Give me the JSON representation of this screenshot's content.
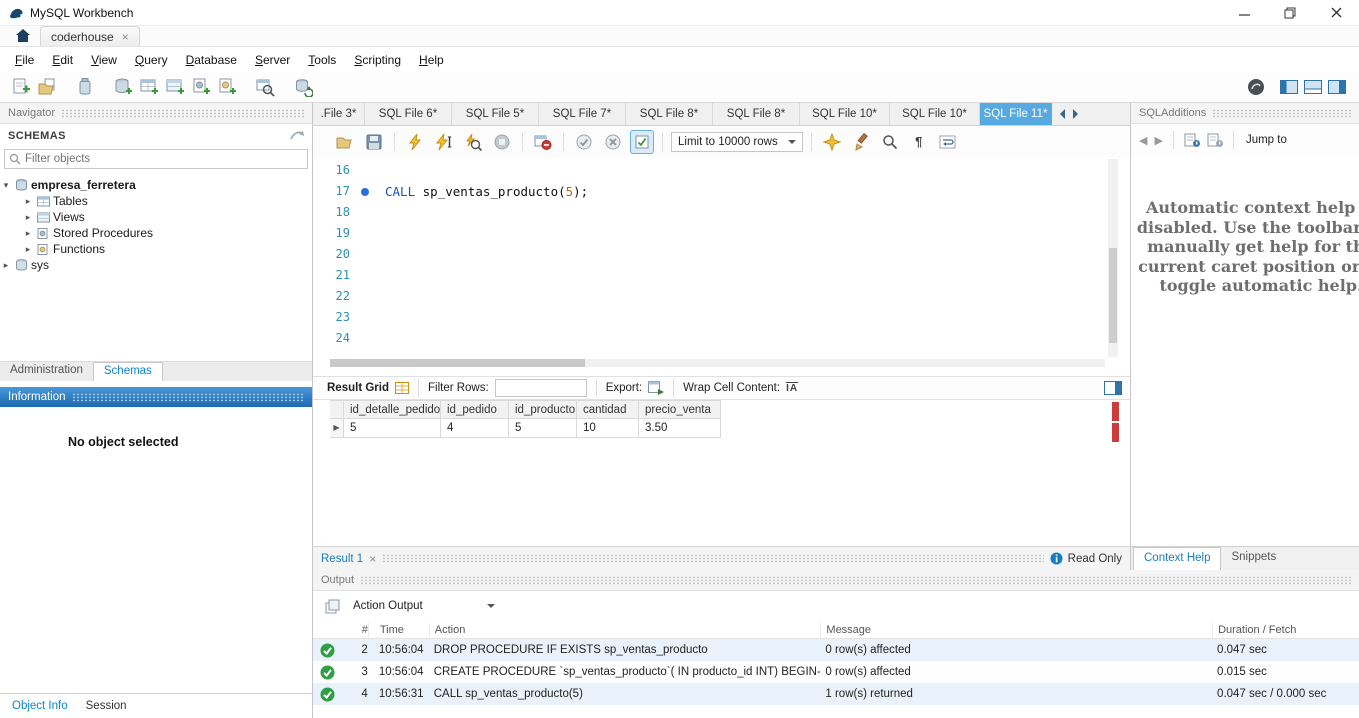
{
  "window": {
    "title": "MySQL Workbench"
  },
  "main_tabs": {
    "tab": "coderhouse",
    "close": "×"
  },
  "menu": {
    "items": [
      "File",
      "Edit",
      "View",
      "Query",
      "Database",
      "Server",
      "Tools",
      "Scripting",
      "Help"
    ]
  },
  "sql_tabs": {
    "items": [
      ".File 3*",
      "SQL File 6*",
      "SQL File 5*",
      "SQL File 7*",
      "SQL File 8*",
      "SQL File 8*",
      "SQL File 10*",
      "SQL File 10*",
      "SQL File 11*"
    ]
  },
  "editor_toolbar": {
    "limit": "Limit to 10000 rows"
  },
  "editor": {
    "line_numbers": [
      "16",
      "17",
      "18",
      "19",
      "20",
      "21",
      "22",
      "23",
      "24"
    ],
    "code_line": {
      "keyword": "CALL",
      "text": " sp_ventas_producto(",
      "number": "5",
      "suffix": ");"
    }
  },
  "navigator": {
    "title": "Navigator",
    "schemas": "SCHEMAS",
    "filter_placeholder": "Filter objects",
    "tree": {
      "schema": "empresa_ferretera",
      "children": [
        "Tables",
        "Views",
        "Stored Procedures",
        "Functions"
      ],
      "schema2": "sys"
    },
    "tabs": {
      "administration": "Administration",
      "schemas": "Schemas"
    }
  },
  "information": {
    "title": "Information",
    "message": "No object selected"
  },
  "bottom_tabs": {
    "object_info": "Object Info",
    "session": "Session"
  },
  "result_toolbar": {
    "grid_label": "Result Grid",
    "filter_label": "Filter Rows:",
    "export_label": "Export:",
    "wrap_label": "Wrap Cell Content:"
  },
  "result_grid": {
    "columns": [
      "id_detalle_pedido",
      "id_pedido",
      "id_producto",
      "cantidad",
      "precio_venta"
    ],
    "rows": [
      [
        "5",
        "4",
        "5",
        "10",
        "3.50"
      ]
    ]
  },
  "result_tab": {
    "label": "Result 1",
    "close": "×",
    "read_only": "Read Only"
  },
  "output": {
    "title": "Output",
    "selector": "Action Output",
    "columns": [
      "#",
      "Time",
      "Action",
      "Message",
      "Duration / Fetch"
    ],
    "rows": [
      {
        "num": "2",
        "time": "10:56:04",
        "action": "DROP PROCEDURE IF EXISTS sp_ventas_producto",
        "message": "0 row(s) affected",
        "duration": "0.047 sec"
      },
      {
        "num": "3",
        "time": "10:56:04",
        "action": "CREATE PROCEDURE `sp_ventas_producto`( IN producto_id INT) BEGIN",
        "ellipsis": "-- ...",
        "message": "0 row(s) affected",
        "duration": "0.015 sec"
      },
      {
        "num": "4",
        "time": "10:56:31",
        "action": "CALL sp_ventas_producto(5)",
        "message": "1 row(s) returned",
        "duration": "0.047 sec / 0.000 sec"
      }
    ]
  },
  "sql_additions": {
    "title": "SQLAdditions",
    "jump_to": "Jump to",
    "help_text": "Automatic context help is disabled. Use the toolbar to manually get help for the current caret position or to toggle automatic help.",
    "tabs": {
      "context_help": "Context Help",
      "snippets": "Snippets"
    }
  },
  "glyphs": {
    "expanded_arrow": "▾",
    "collapsed_arrow": "▸",
    "row_pointer": "▶",
    "pilcrow": "¶",
    "wrap_cell": "IA",
    "back_arrow": "◀",
    "forward_arrow": "▶"
  },
  "colors": {
    "accent_blue": "#0a85d1",
    "active_tab_blue": "#57a9e2",
    "keyword_blue": "#1f4fc8",
    "number_orange": "#c06a10",
    "line_number_teal": "#2b91af",
    "success_green": "#2f9e44",
    "marker_red": "#cf3a3a"
  }
}
